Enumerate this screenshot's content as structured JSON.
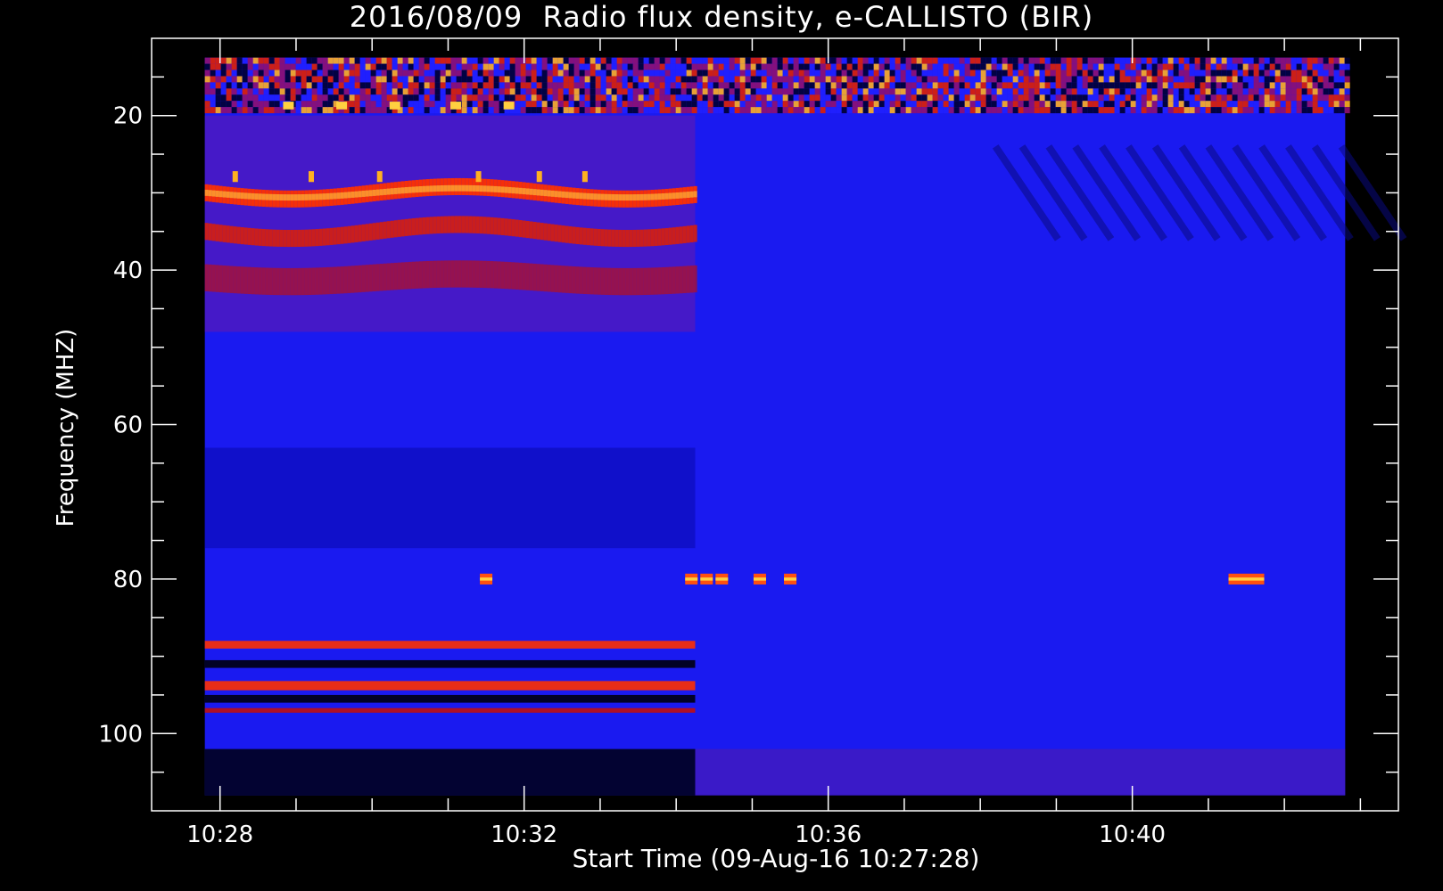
{
  "chart_data": {
    "type": "heatmap",
    "title": "2016/08/09  Radio flux density, e-CALLISTO (BIR)",
    "xlabel": "Start Time (09-Aug-16 10:27:28)",
    "ylabel": "Frequency (MHZ)",
    "x_tick_labels": [
      "10:28",
      "10:32",
      "10:36",
      "10:40"
    ],
    "y_tick_labels": [
      "20",
      "40",
      "60",
      "80",
      "100"
    ],
    "y_ticks": [
      20,
      40,
      60,
      80,
      100
    ],
    "x_ticks_minutes": [
      28,
      32,
      36,
      40
    ],
    "x_range_minutes": [
      27.1,
      43.5
    ],
    "x_data_range_minutes": [
      27.8,
      42.8
    ],
    "y_range": [
      10,
      110
    ],
    "y_data_range": [
      12.5,
      108
    ],
    "y_reversed": true,
    "data_switch_minute": 34.25,
    "colormap": [
      "#000000",
      "#1010ff",
      "#c01010",
      "#ff3000",
      "#ffd040"
    ],
    "features": [
      {
        "name": "interference band",
        "freq_mhz": 30,
        "t_start_min": 27.8,
        "t_end_min": 34.25,
        "level": "high"
      },
      {
        "name": "interference band",
        "freq_mhz": 35,
        "t_start_min": 27.8,
        "t_end_min": 34.25,
        "level": "medium"
      },
      {
        "name": "interference band",
        "freq_mhz": 89,
        "t_start_min": 27.8,
        "t_end_min": 34.25,
        "level": "medium"
      },
      {
        "name": "interference band",
        "freq_mhz": 94,
        "t_start_min": 27.8,
        "t_end_min": 34.25,
        "level": "medium"
      },
      {
        "name": "bursts",
        "freq_mhz": 80,
        "times_min": [
          31.5,
          34.2,
          34.4,
          34.6,
          35.1,
          35.5,
          41.5
        ],
        "level": "high"
      }
    ]
  }
}
